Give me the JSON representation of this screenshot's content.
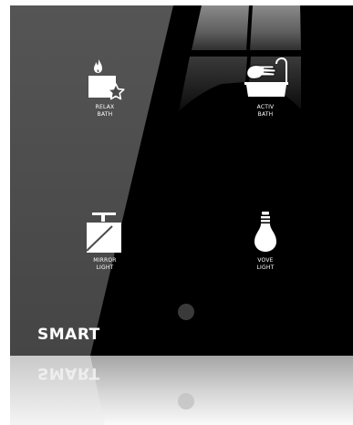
{
  "brand": "SMART",
  "buttons": {
    "relax_bath": {
      "label": "RELAX\nBATH",
      "icon": "relax-bath-icon"
    },
    "activ_bath": {
      "label": "ACTIV\nBATH",
      "icon": "activ-bath-icon"
    },
    "mirror_light": {
      "label": "MIRROR\nLIGHT",
      "icon": "mirror-light-icon"
    },
    "vove_light": {
      "label": "VOVE\nLIGHT",
      "icon": "vove-light-icon"
    }
  },
  "colors": {
    "panel": "#000000",
    "panel_left": "#4a4a4a",
    "text": "#ffffff",
    "dot": "#3a3a3a"
  }
}
